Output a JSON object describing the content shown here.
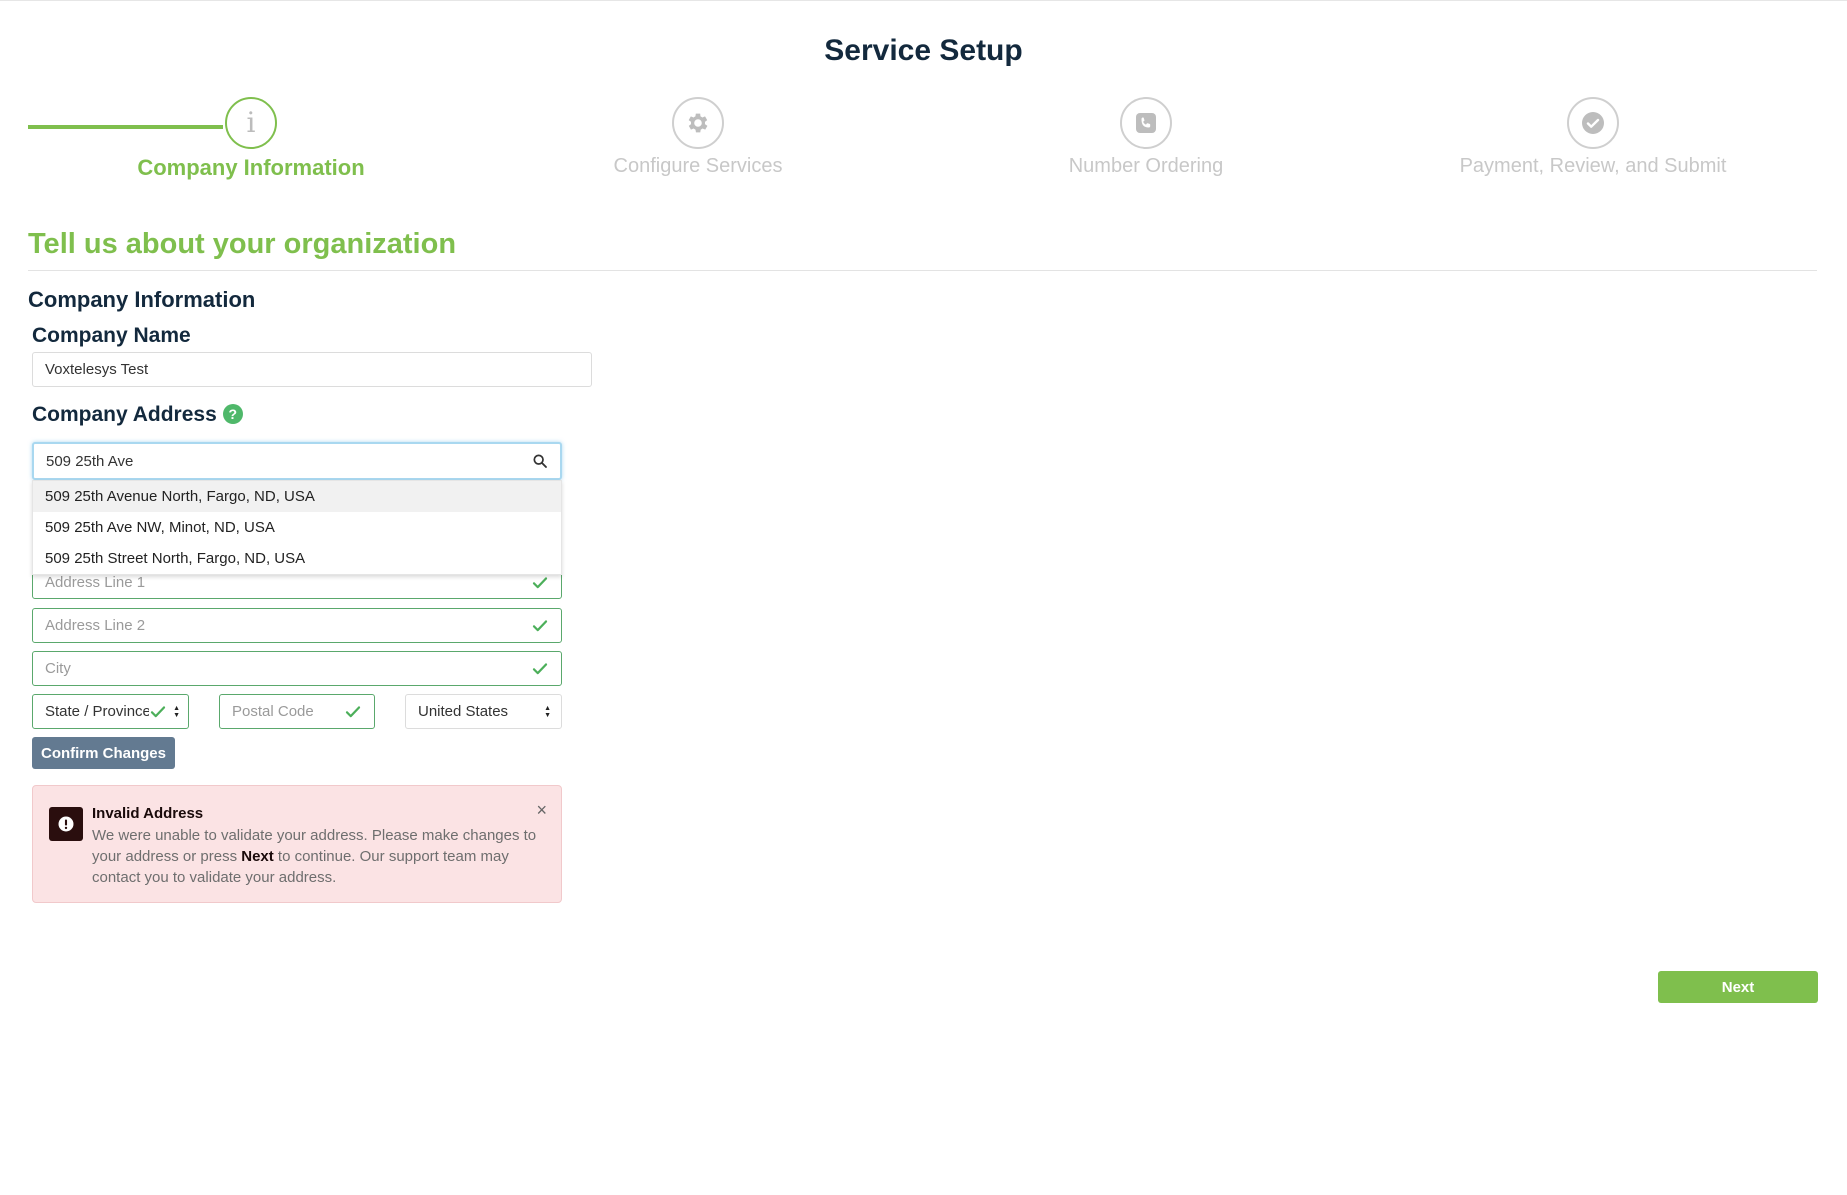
{
  "page": {
    "title": "Service Setup"
  },
  "stepper": {
    "steps": [
      {
        "label": "Company Information",
        "icon": "info-icon",
        "active": true
      },
      {
        "label": "Configure Services",
        "icon": "gear-icon",
        "active": false
      },
      {
        "label": "Number Ordering",
        "icon": "phone-icon",
        "active": false
      },
      {
        "label": "Payment, Review, and Submit",
        "icon": "check-circle-icon",
        "active": false
      }
    ],
    "accent_color": "#7fbf4d"
  },
  "form": {
    "heading": "Tell us about your organization",
    "section_title": "Company Information",
    "company_name": {
      "label": "Company Name",
      "value": "Voxtelesys Test"
    },
    "company_address": {
      "label": "Company Address",
      "help": "?",
      "search_value": "509 25th Ave",
      "suggestions": [
        "509 25th Avenue North, Fargo, ND, USA",
        "509 25th Ave NW, Minot, ND, USA",
        "509 25th Street North, Fargo, ND, USA"
      ],
      "address_line1_placeholder": "Address Line 1",
      "address_line2_placeholder": "Address Line 2",
      "city_placeholder": "City",
      "state_placeholder": "State / Province",
      "postal_placeholder": "Postal Code",
      "country_value": "United States"
    },
    "confirm_label": "Confirm Changes"
  },
  "alert": {
    "title": "Invalid Address",
    "body_before": "We were unable to validate your address. Please make changes to your address or press ",
    "body_bold": "Next",
    "body_after": " to continue. Our support team may contact you to validate your address.",
    "close": "×",
    "color": "#fbe3e4"
  },
  "footer": {
    "next_label": "Next"
  }
}
